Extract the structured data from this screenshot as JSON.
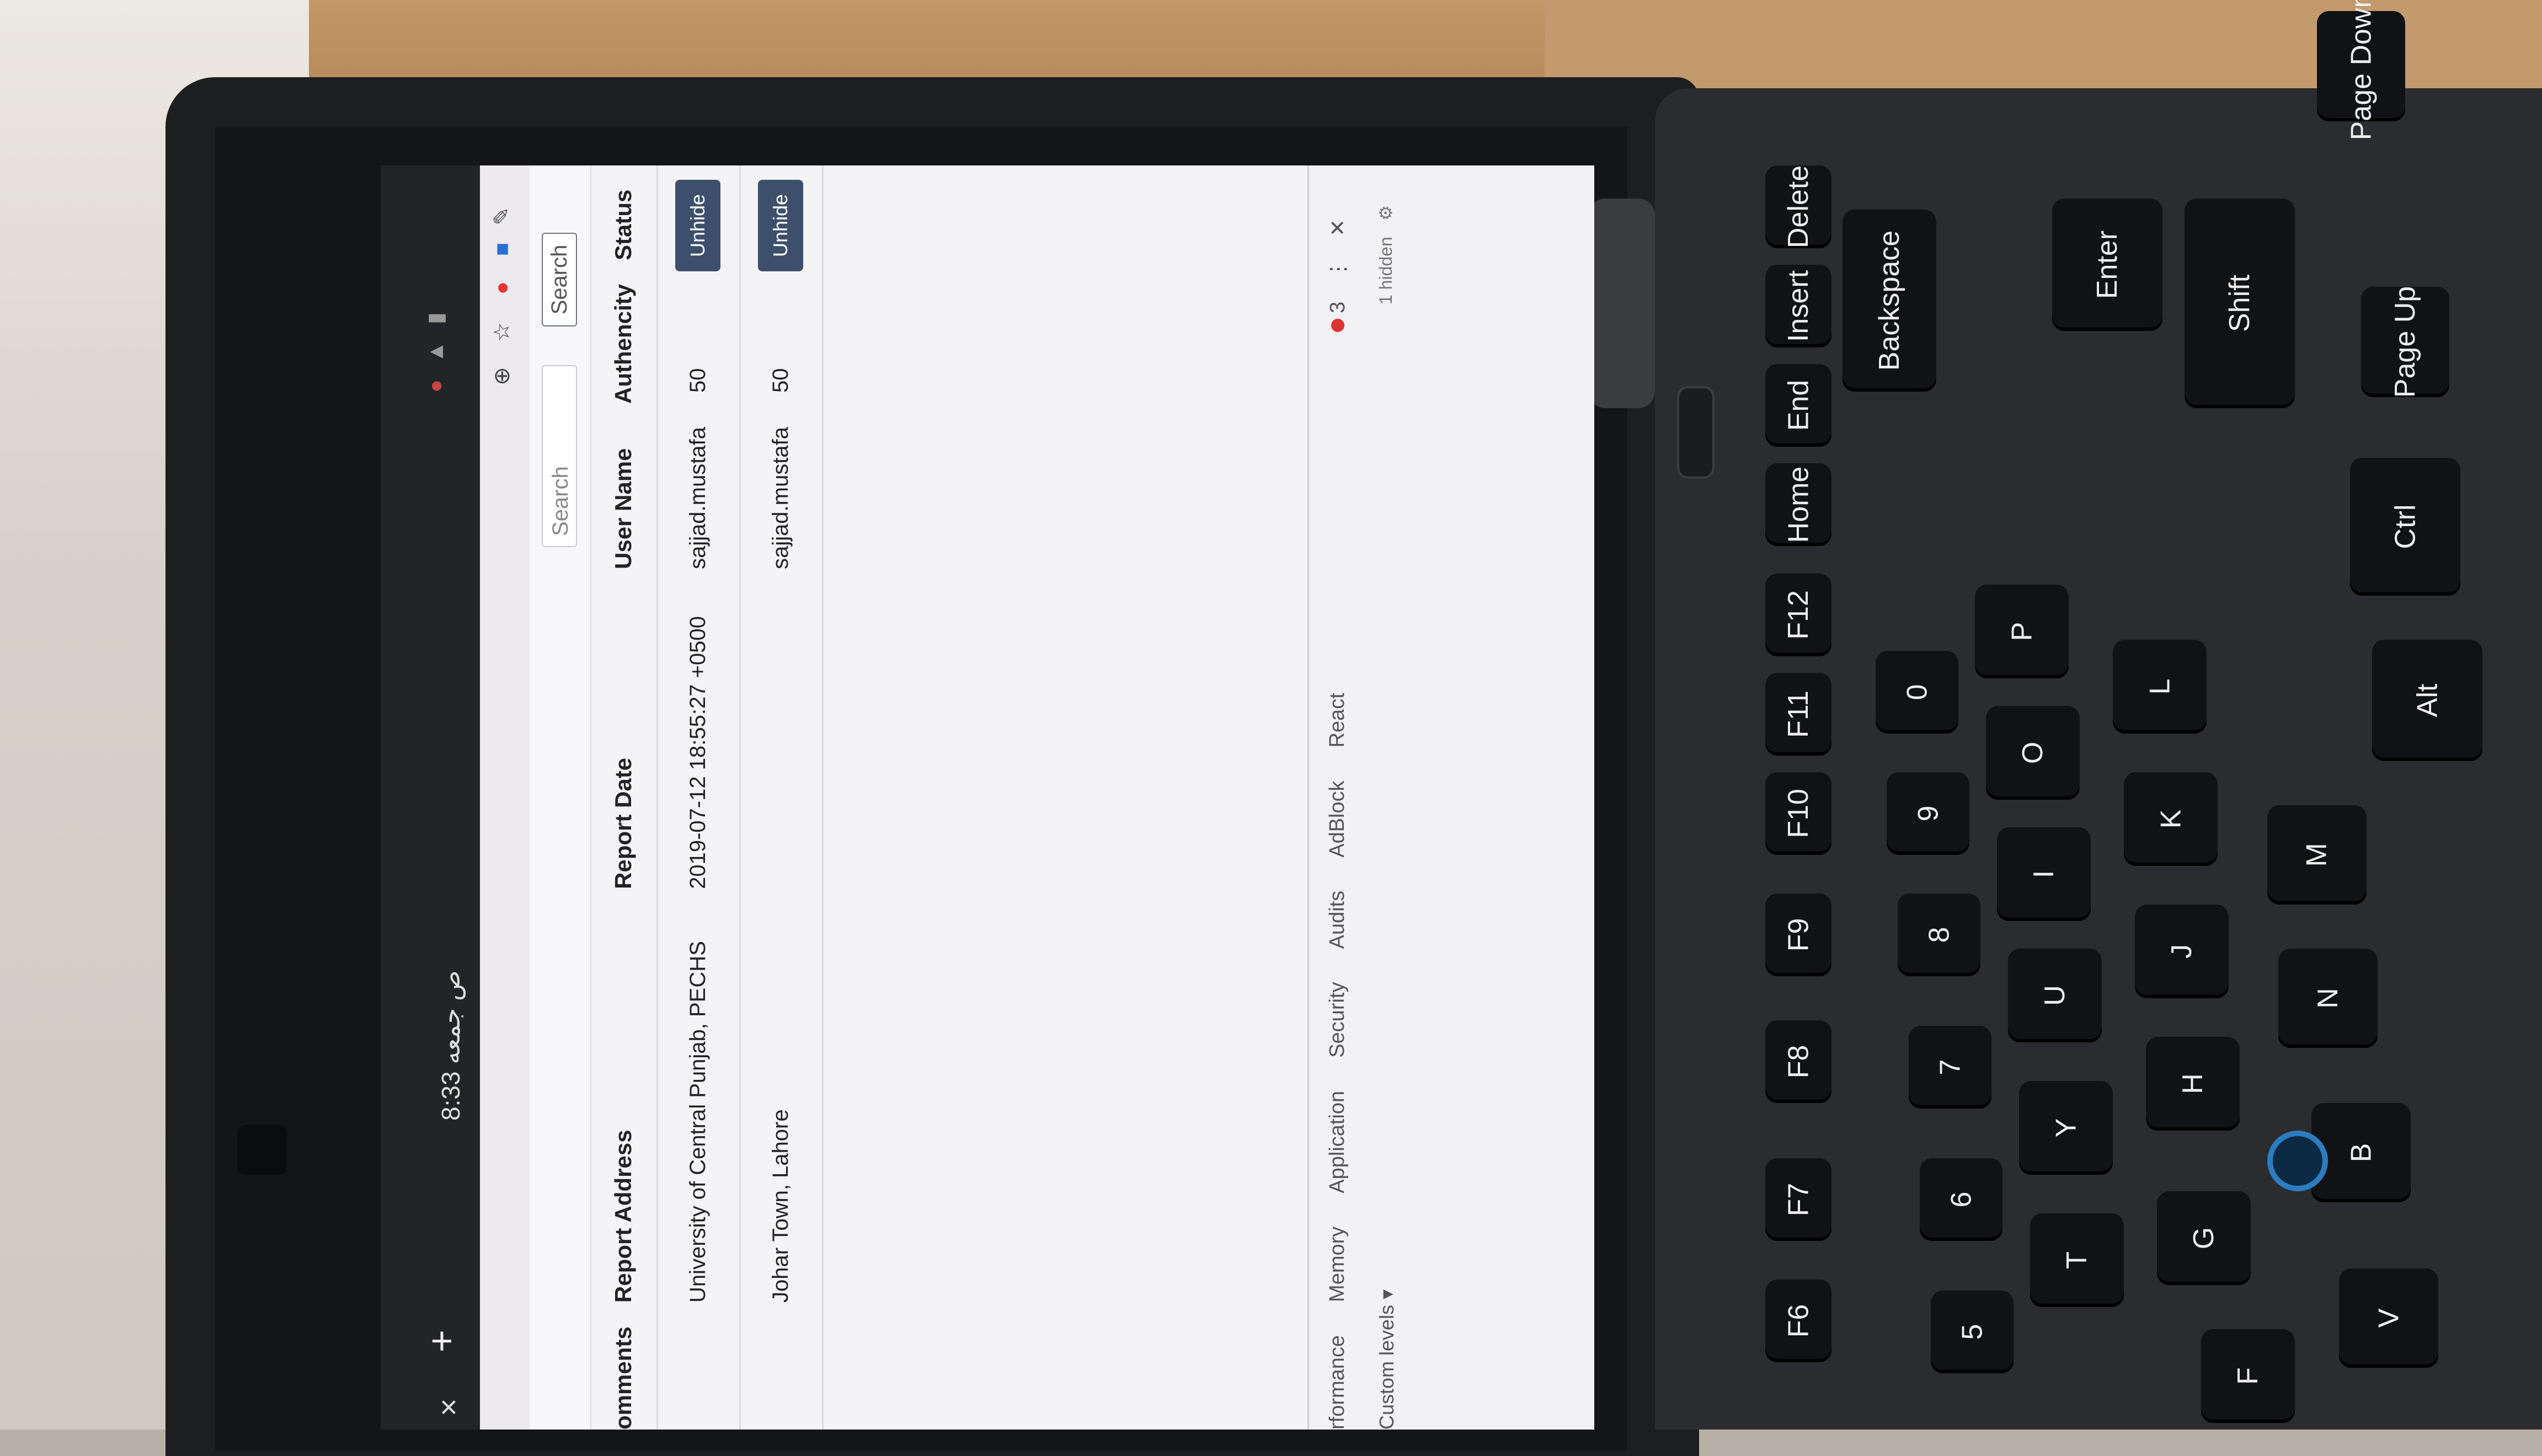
{
  "browser": {
    "tab_close": "×",
    "new_tab": "+",
    "clock": "8:33 ص",
    "clock_day": "جمعه"
  },
  "nav": {
    "search_placeholder": "Search",
    "search_button": "Search"
  },
  "table": {
    "headers": [
      "omments",
      "Report Address",
      "Report Date",
      "User Name",
      "Authencity",
      "Status"
    ],
    "rows": [
      {
        "address": "University of Central Punjab, PECHS",
        "date": "2019-07-12 18:55:27 +0500",
        "user": "sajjad.mustafa",
        "authencity": "50",
        "status": "Unhide"
      },
      {
        "address": "Johar Town, Lahore",
        "date": "",
        "user": "sajjad.mustafa",
        "authencity": "50",
        "status": "Unhide"
      }
    ]
  },
  "devtools": {
    "tabs": [
      "rformance",
      "Memory",
      "Application",
      "Security",
      "Audits",
      "AdBlock",
      "React"
    ],
    "custom_levels": "Custom levels ▾",
    "error_count": "3",
    "hidden": "1 hidden"
  },
  "keyboard": {
    "keys": [
      "Delete",
      "Insert",
      "End",
      "Home",
      "F12",
      "F11",
      "F10",
      "F9",
      "F8",
      "F7",
      "F6",
      "Backspace",
      "Enter",
      "Shift",
      "Page Up",
      "Page Down",
      "Ctrl",
      "Alt",
      "P",
      "O",
      "I",
      "U",
      "Y",
      "T",
      "L",
      "K",
      "J",
      "H",
      "G",
      "F",
      "M",
      "N",
      "B",
      "V",
      "0",
      "9",
      "8",
      "7",
      "6",
      "5"
    ]
  },
  "colors": {
    "unhide_button": "#3d4f6a",
    "trackpoint": "#2c7cc0"
  }
}
